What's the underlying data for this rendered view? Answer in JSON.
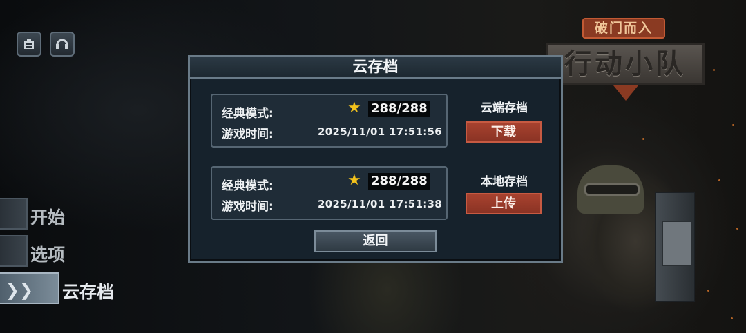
{
  "logo": {
    "subtitle": "破门而入",
    "title": "行动小队"
  },
  "top_buttons": [
    {
      "icon": "notice-board-icon"
    },
    {
      "icon": "headset-icon"
    }
  ],
  "side_menu": {
    "items": [
      {
        "label": "开始"
      },
      {
        "label": "选项"
      },
      {
        "label": "云存档",
        "active": true
      }
    ]
  },
  "dialog": {
    "title": "云存档",
    "cloud_save": {
      "mode_label": "经典模式:",
      "score": "288/288",
      "time_label": "游戏时间:",
      "time_value": "2025/11/01  17:51:56",
      "side_label": "云端存档",
      "action": "下载"
    },
    "local_save": {
      "mode_label": "经典模式:",
      "score": "288/288",
      "time_label": "游戏时间:",
      "time_value": "2025/11/01  17:51:38",
      "side_label": "本地存档",
      "action": "上传"
    },
    "back": "返回"
  },
  "colors": {
    "accent_red": "#a8422f",
    "star": "#f2c21c",
    "panel": "#16222c",
    "border": "#6a7b88"
  }
}
